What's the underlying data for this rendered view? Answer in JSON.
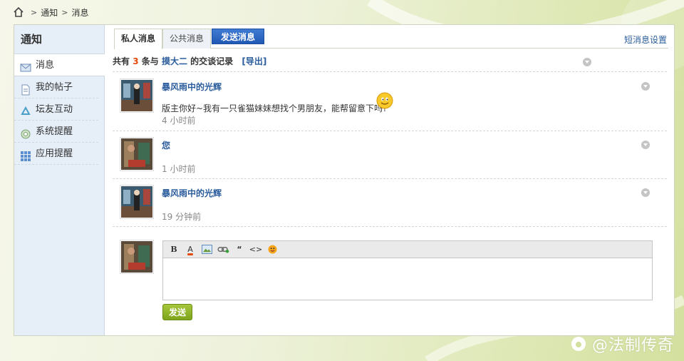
{
  "breadcrumb": {
    "items": [
      "通知",
      "消息"
    ]
  },
  "sidebar": {
    "title": "通知",
    "items": [
      {
        "label": "消息",
        "icon": "mail-icon"
      },
      {
        "label": "我的帖子",
        "icon": "document-icon"
      },
      {
        "label": "坛友互动",
        "icon": "recycle-icon"
      },
      {
        "label": "系统提醒",
        "icon": "gear-icon"
      },
      {
        "label": "应用提醒",
        "icon": "grid-icon"
      }
    ]
  },
  "tabs": {
    "private": "私人消息",
    "public": "公共消息",
    "send": "发送消息"
  },
  "settings_link": "短消息设置",
  "summary": {
    "prefix": "共有",
    "count": "3",
    "middle": "条与",
    "partner": "摸大二",
    "suffix": "的交谈记录",
    "export": "[导出]"
  },
  "messages": [
    {
      "author": "暴风雨中的光辉",
      "text": "版主你好~我有一只雀猫妹妹想找个男朋友，能帮留意下吗?",
      "time": "4 小时前"
    },
    {
      "author": "您",
      "text": "",
      "time": "1 小时前"
    },
    {
      "author": "暴风雨中的光辉",
      "text": "",
      "time": "19 分钟前"
    }
  ],
  "editor": {
    "toolbar": [
      "B",
      "A",
      "image-icon",
      "link-icon",
      "quote-icon",
      "code-icon",
      "emoticon-icon"
    ],
    "bold_label": "B",
    "color_label": "A",
    "quote_label": "“",
    "code_label": "<>",
    "placeholder": ""
  },
  "send_button": "发送",
  "watermark": "@法制传奇",
  "colors": {
    "link": "#2a5c9c",
    "count": "#e4490b",
    "send_tab": "#2a63bd",
    "send_button": "#8cb226",
    "sidebar_bg": "#e6eef8"
  }
}
